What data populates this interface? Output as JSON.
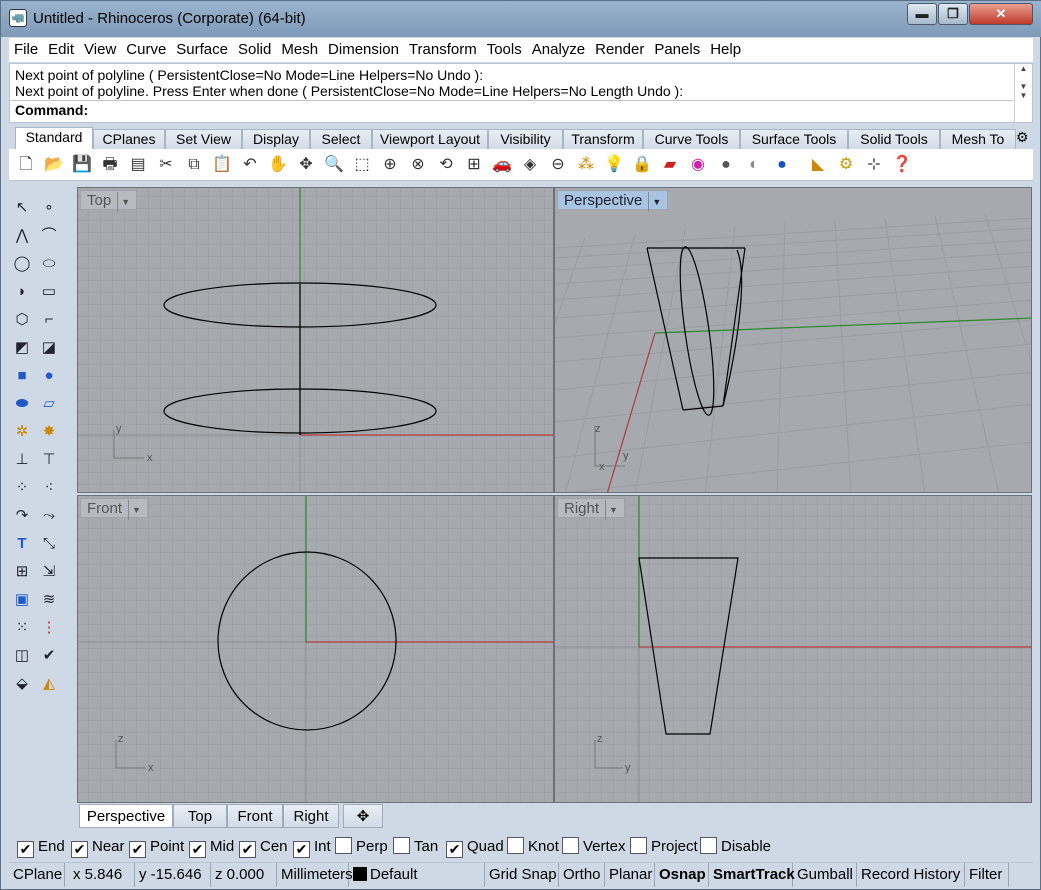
{
  "window": {
    "title": "Untitled - Rhinoceros (Corporate) (64-bit)",
    "minimize": "▬",
    "maximize": "❐",
    "close": "✕"
  },
  "menu": [
    "File",
    "Edit",
    "View",
    "Curve",
    "Surface",
    "Solid",
    "Mesh",
    "Dimension",
    "Transform",
    "Tools",
    "Analyze",
    "Render",
    "Panels",
    "Help"
  ],
  "command": {
    "line1": "Next point of polyline ( PersistentClose=No  Mode=Line  Helpers=No  Undo ):",
    "line2": "Next point of polyline. Press Enter when done ( PersistentClose=No  Mode=Line  Helpers=No  Length  Undo ):",
    "prompt": "Command:"
  },
  "toolbar_tabs": [
    "Standard",
    "CPlanes",
    "Set View",
    "Display",
    "Select",
    "Viewport Layout",
    "Visibility",
    "Transform",
    "Curve Tools",
    "Surface Tools",
    "Solid Tools",
    "Mesh To"
  ],
  "viewports": {
    "top": "Top",
    "perspective": "Perspective",
    "front": "Front",
    "right": "Right"
  },
  "axis_labels": {
    "x": "x",
    "y": "y",
    "z": "z"
  },
  "viewport_tabs": [
    "Perspective",
    "Top",
    "Front",
    "Right"
  ],
  "viewport_tab_add": "✥",
  "osnaps": [
    {
      "label": "End",
      "checked": true
    },
    {
      "label": "Near",
      "checked": true
    },
    {
      "label": "Point",
      "checked": true
    },
    {
      "label": "Mid",
      "checked": true
    },
    {
      "label": "Cen",
      "checked": true
    },
    {
      "label": "Int",
      "checked": true
    },
    {
      "label": "Perp",
      "checked": false
    },
    {
      "label": "Tan",
      "checked": false
    },
    {
      "label": "Quad",
      "checked": true
    },
    {
      "label": "Knot",
      "checked": false
    },
    {
      "label": "Vertex",
      "checked": false
    },
    {
      "label": "Project",
      "checked": false
    },
    {
      "label": "Disable",
      "checked": false
    }
  ],
  "status": {
    "cplane": "CPlane",
    "x": "x 5.846",
    "y": "y -15.646",
    "z": "z 0.000",
    "units": "Millimeters",
    "layer": "Default",
    "grid_snap": "Grid Snap",
    "ortho": "Ortho",
    "planar": "Planar",
    "osnap": "Osnap",
    "smarttrack": "SmartTrack",
    "gumball": "Gumball",
    "record_history": "Record History",
    "filter": "Filter"
  }
}
